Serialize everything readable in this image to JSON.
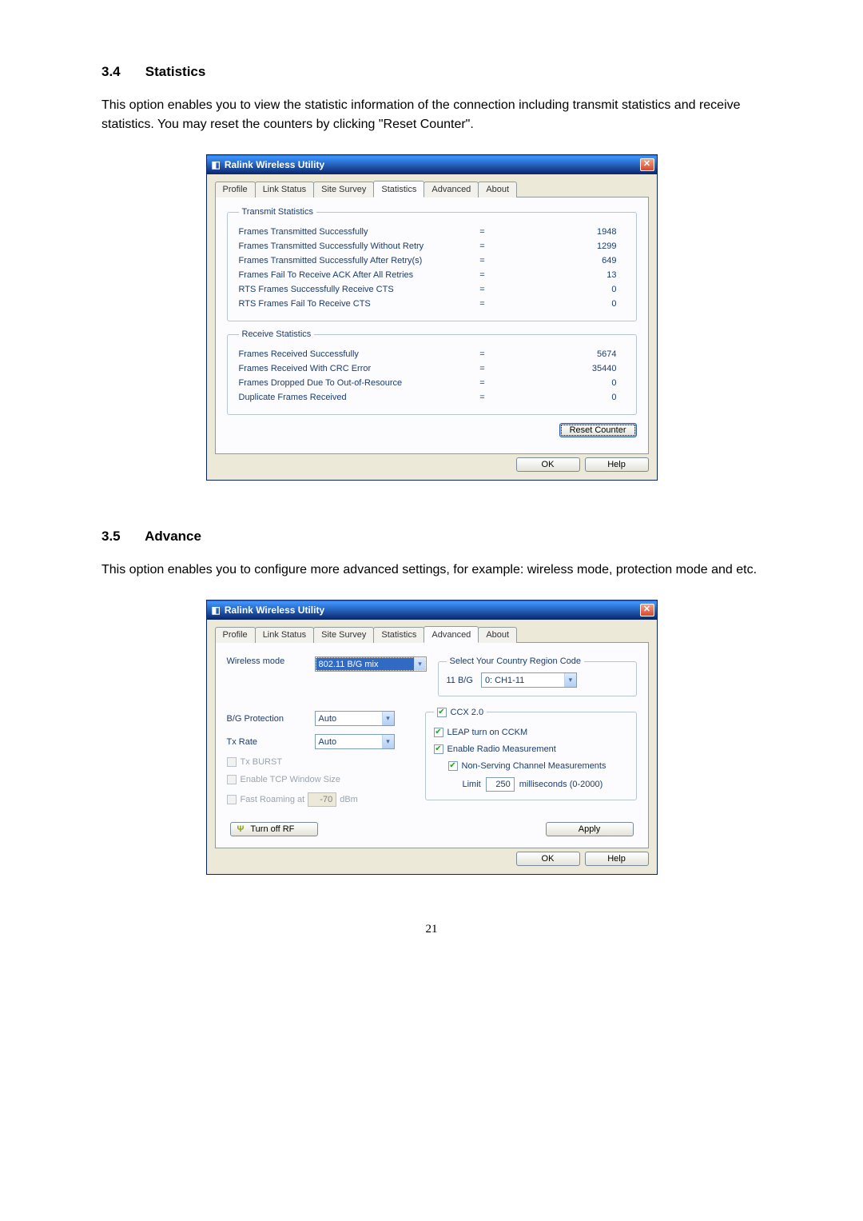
{
  "page_number": "21",
  "section1": {
    "num": "3.4",
    "title": "Statistics",
    "paragraph": "This option enables you to view the statistic information of the connection including transmit statistics and receive statistics. You may reset the counters by clicking \"Reset Counter\"."
  },
  "section2": {
    "num": "3.5",
    "title": "Advance",
    "paragraph": "This option enables you to configure more advanced settings, for example: wireless mode, protection mode and etc."
  },
  "dialog_title": "Ralink Wireless Utility",
  "tabs": [
    "Profile",
    "Link Status",
    "Site Survey",
    "Statistics",
    "Advanced",
    "About"
  ],
  "stats_dialog": {
    "active_tab": "Statistics",
    "transmit_legend": "Transmit Statistics",
    "receive_legend": "Receive Statistics",
    "transmit": [
      {
        "label": "Frames Transmitted Successfully",
        "value": "1948"
      },
      {
        "label": "Frames Transmitted Successfully Without Retry",
        "value": "1299"
      },
      {
        "label": "Frames Transmitted Successfully After Retry(s)",
        "value": "649"
      },
      {
        "label": "Frames Fail To Receive ACK After All Retries",
        "value": "13"
      },
      {
        "label": "RTS Frames Successfully Receive CTS",
        "value": "0"
      },
      {
        "label": "RTS Frames Fail To Receive CTS",
        "value": "0"
      }
    ],
    "receive": [
      {
        "label": "Frames Received Successfully",
        "value": "5674"
      },
      {
        "label": "Frames Received With CRC Error",
        "value": "35440"
      },
      {
        "label": "Frames Dropped Due To Out-of-Resource",
        "value": "0"
      },
      {
        "label": "Duplicate Frames Received",
        "value": "0"
      }
    ],
    "reset_btn": "Reset Counter",
    "ok_btn": "OK",
    "help_btn": "Help"
  },
  "adv_dialog": {
    "active_tab": "Advanced",
    "wireless_mode_label": "Wireless mode",
    "wireless_mode_value": "802.11 B/G mix",
    "country_legend": "Select Your Country Region Code",
    "country_label": "11 B/G",
    "country_value": "0: CH1-11",
    "bg_protection_label": "B/G Protection",
    "bg_protection_value": "Auto",
    "tx_rate_label": "Tx Rate",
    "tx_rate_value": "Auto",
    "tx_burst_label": "Tx BURST",
    "tcp_window_label": "Enable TCP Window Size",
    "fast_roaming_label": "Fast Roaming at",
    "fast_roaming_value": "-70",
    "fast_roaming_unit": "dBm",
    "ccx_legend": "CCX 2.0",
    "leap_label": "LEAP turn on CCKM",
    "radio_meas_label": "Enable Radio Measurement",
    "non_serving_label": "Non-Serving Channel Measurements",
    "limit_label": "Limit",
    "limit_value": "250",
    "limit_unit": "milliseconds (0-2000)",
    "turn_off_rf": "Turn off RF",
    "apply_btn": "Apply",
    "ok_btn": "OK",
    "help_btn": "Help"
  }
}
